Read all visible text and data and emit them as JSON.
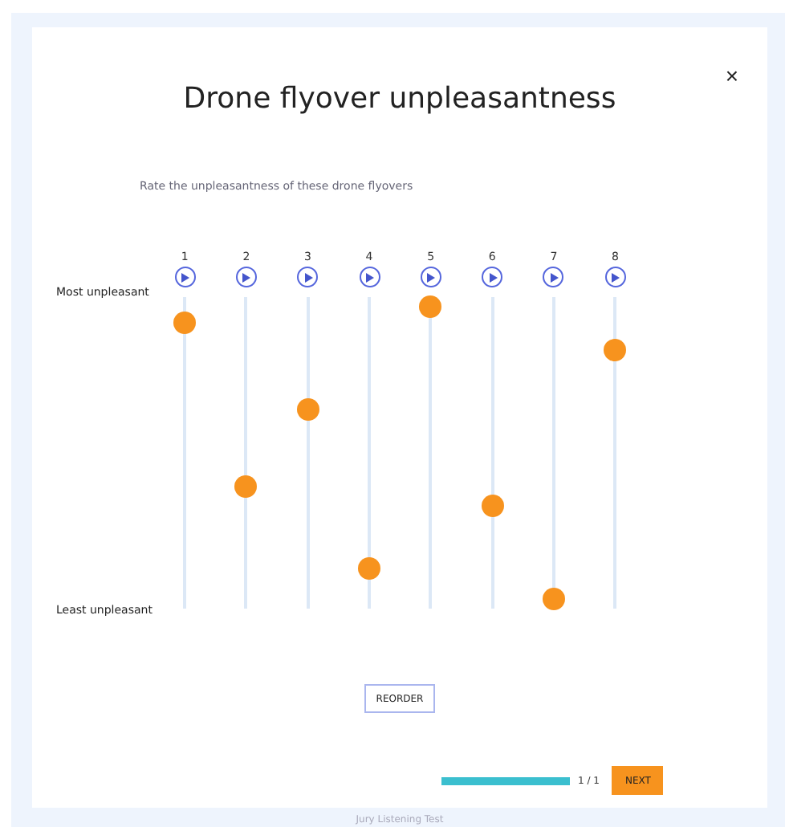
{
  "dialog": {
    "title": "Drone flyover unpleasantness",
    "close": "×"
  },
  "instruction": "Rate the unpleasantness of these drone flyovers",
  "scale": {
    "top_label": "Most unpleasant",
    "bottom_label": "Least unpleasant"
  },
  "sliders": [
    {
      "label": "1",
      "level": 0.92
    },
    {
      "label": "2",
      "level": 0.39
    },
    {
      "label": "3",
      "level": 0.64
    },
    {
      "label": "4",
      "level": 0.13
    },
    {
      "label": "5",
      "level": 0.97
    },
    {
      "label": "6",
      "level": 0.33
    },
    {
      "label": "7",
      "level": 0.03
    },
    {
      "label": "8",
      "level": 0.83
    }
  ],
  "reorder_button": "REORDER",
  "progress": {
    "level": 1,
    "reading": "1 / 1"
  },
  "next_button": "NEXT",
  "footer": "Jury Listening Test"
}
